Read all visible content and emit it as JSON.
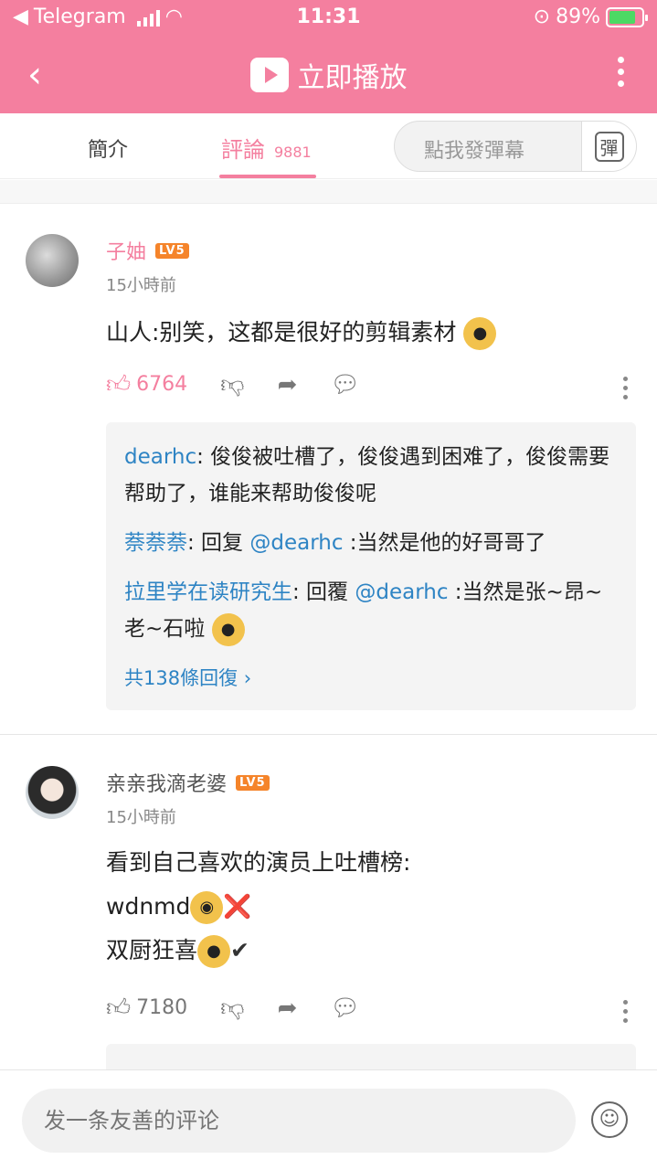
{
  "status": {
    "app": "Telegram",
    "time": "11:31",
    "battery": "89%"
  },
  "nav": {
    "back": "‹",
    "title": "立即播放"
  },
  "tabs": {
    "intro": "簡介",
    "comments": "評論",
    "comments_count": "9881"
  },
  "danmaku": {
    "placeholder": "點我發彈幕",
    "button": "彈"
  },
  "comments": [
    {
      "user": "子妯",
      "level": "LV5",
      "time": "15小時前",
      "text": "山人:别笑，这都是很好的剪辑素材",
      "likes": "6764",
      "replies": [
        {
          "name": "dearhc",
          "text": ": 俊俊被吐槽了，俊俊遇到困难了，俊俊需要帮助了，谁能来帮助俊俊呢"
        },
        {
          "name": "萘萘萘",
          "text": ": 回复 ",
          "mention": "@dearhc",
          "tail": " :当然是他的好哥哥了"
        },
        {
          "name": "拉里学在读研究生",
          "text": ": 回覆 ",
          "mention": "@dearhc",
          "tail": " :当然是张~昂~老~石啦"
        }
      ],
      "more_replies": "共138條回復 ›"
    },
    {
      "user": "亲亲我滴老婆",
      "level": "LV5",
      "time": "15小時前",
      "line1": "看到自己喜欢的演员上吐槽榜:",
      "line2": "wdnmd",
      "line3": "双厨狂喜",
      "mark_x": "❌",
      "mark_check": "✔",
      "likes": "7180"
    }
  ],
  "input": {
    "placeholder": "发一条友善的评论"
  }
}
